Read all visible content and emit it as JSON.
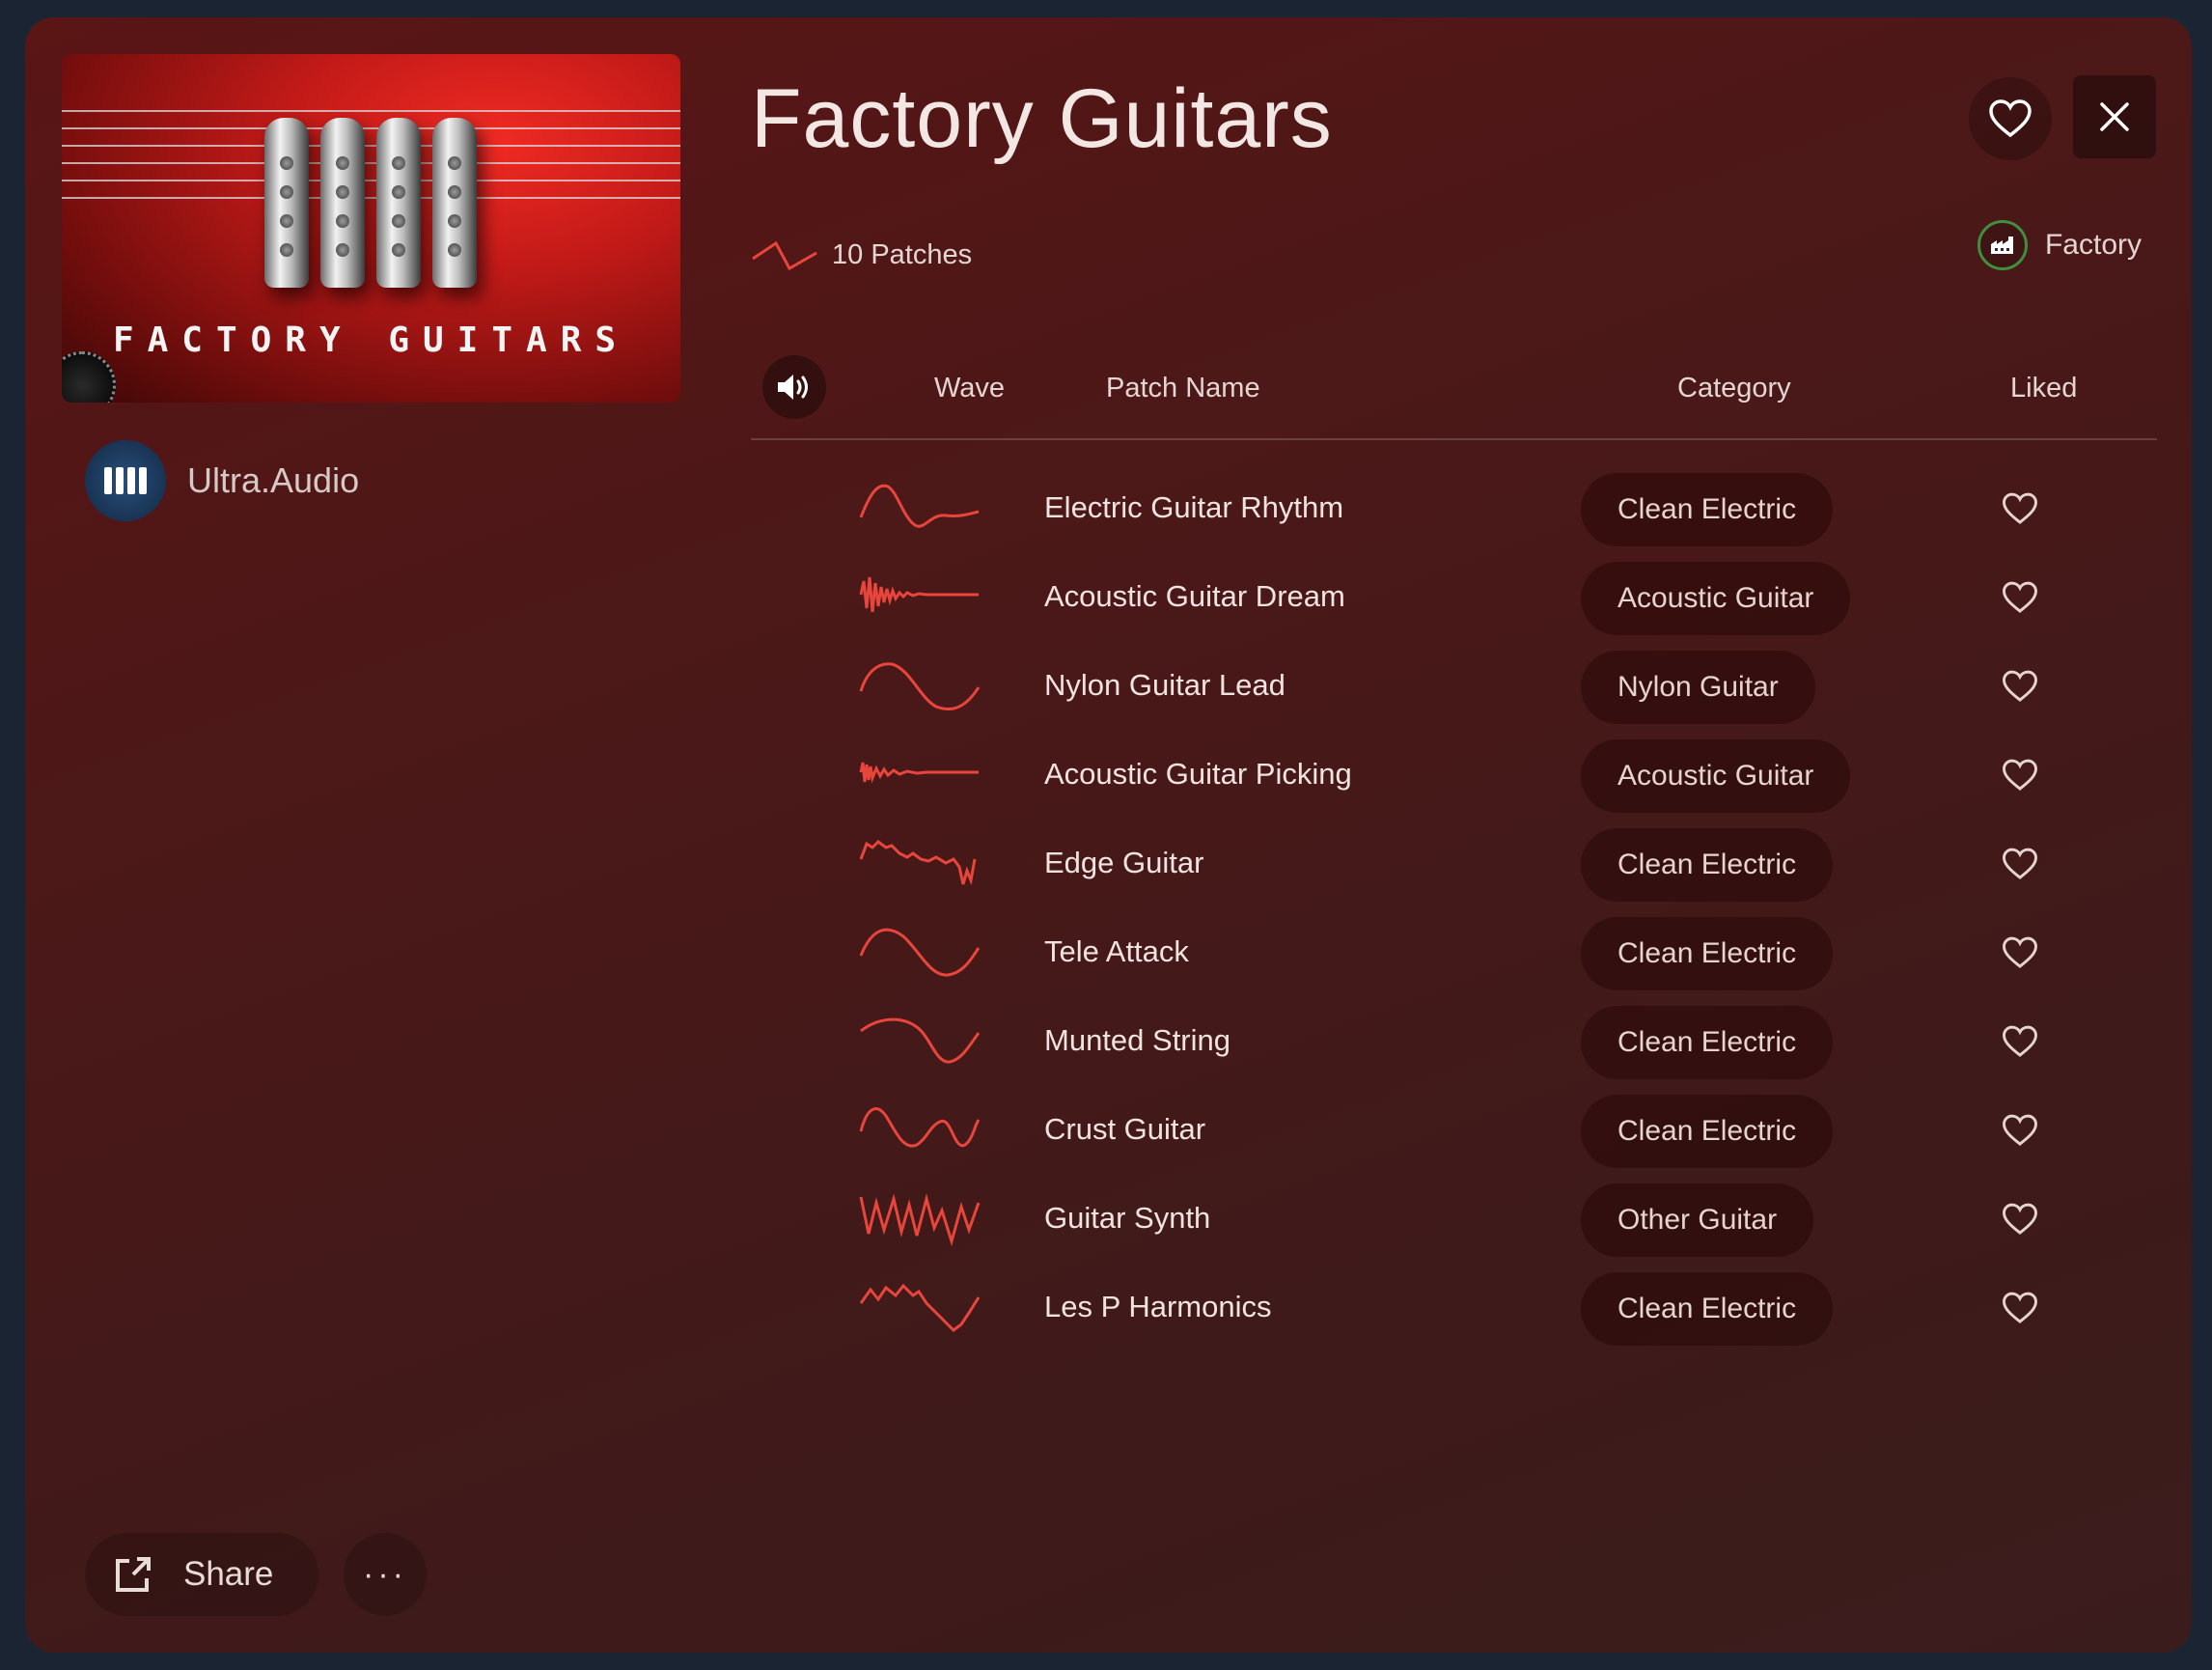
{
  "cover": {
    "title": "FACTORY GUITARS"
  },
  "author": {
    "name": "Ultra.Audio"
  },
  "header": {
    "title": "Factory Guitars",
    "patch_count": "10 Patches",
    "source_label": "Factory"
  },
  "icons": {
    "favorite": "heart-outline-icon",
    "close": "close-icon",
    "patches": "waveform-zigzag-icon",
    "factory": "factory-icon",
    "preview": "speaker-icon",
    "share": "share-external-icon",
    "more": "ellipsis-icon",
    "author": "piano-keys-icon"
  },
  "table": {
    "columns": {
      "wave": "Wave",
      "name": "Patch Name",
      "category": "Category",
      "liked": "Liked"
    },
    "rows": [
      {
        "name": "Electric Guitar Rhythm",
        "category": "Clean Electric",
        "liked": false
      },
      {
        "name": "Acoustic Guitar Dream",
        "category": "Acoustic Guitar",
        "liked": false
      },
      {
        "name": "Nylon Guitar Lead",
        "category": "Nylon Guitar",
        "liked": false
      },
      {
        "name": "Acoustic Guitar Picking",
        "category": "Acoustic Guitar",
        "liked": false
      },
      {
        "name": "Edge Guitar",
        "category": "Clean Electric",
        "liked": false
      },
      {
        "name": "Tele Attack",
        "category": "Clean Electric",
        "liked": false
      },
      {
        "name": "Munted String",
        "category": "Clean Electric",
        "liked": false
      },
      {
        "name": "Crust Guitar",
        "category": "Clean Electric",
        "liked": false
      },
      {
        "name": "Guitar Synth",
        "category": "Other Guitar",
        "liked": false
      },
      {
        "name": "Les P Harmonics",
        "category": "Clean Electric",
        "liked": false
      }
    ]
  },
  "footer": {
    "share_label": "Share",
    "more_label": "···"
  },
  "colors": {
    "accent_wave": "#e8453c",
    "panel_top": "#5a1515",
    "panel_bottom": "#3b1c1c",
    "factory_ring": "#3f8f3f"
  }
}
